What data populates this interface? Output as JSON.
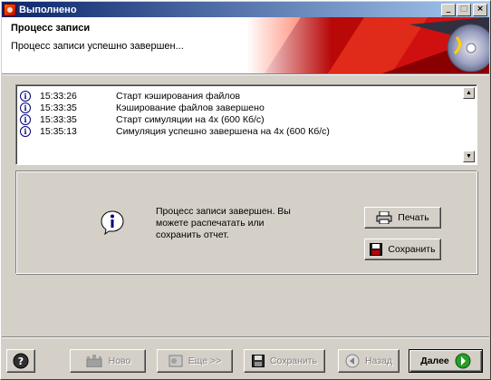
{
  "window": {
    "title": "Выполнено",
    "controls": {
      "minimize": "_",
      "maximize": "□",
      "close": "×"
    }
  },
  "header": {
    "title": "Процесс записи",
    "subtitle": "Процесс записи успешно завершен..."
  },
  "log": {
    "rows": [
      {
        "time": "15:33:26",
        "message": "Старт кэширования файлов"
      },
      {
        "time": "15:33:35",
        "message": "Кэширование файлов завершено"
      },
      {
        "time": "15:33:35",
        "message": "Старт симуляции на 4x (600 Кб/с)"
      },
      {
        "time": "15:35:13",
        "message": "Симуляция успешно завершена на 4x (600 Кб/с)"
      }
    ]
  },
  "status": {
    "message": "Процесс записи завершен. Вы можете распечатать или сохранить отчет.",
    "print_label": "Печать",
    "save_label": "Сохранить"
  },
  "footer": {
    "help_label": "",
    "new_label": "Ново",
    "more_label": "Еще >>",
    "save_label": "Сохранить",
    "back_label": "Назад",
    "next_label": "Далее"
  },
  "colors": {
    "accent": "#0a246a",
    "face": "#d4d0c8",
    "banner_red": "#d01010"
  }
}
